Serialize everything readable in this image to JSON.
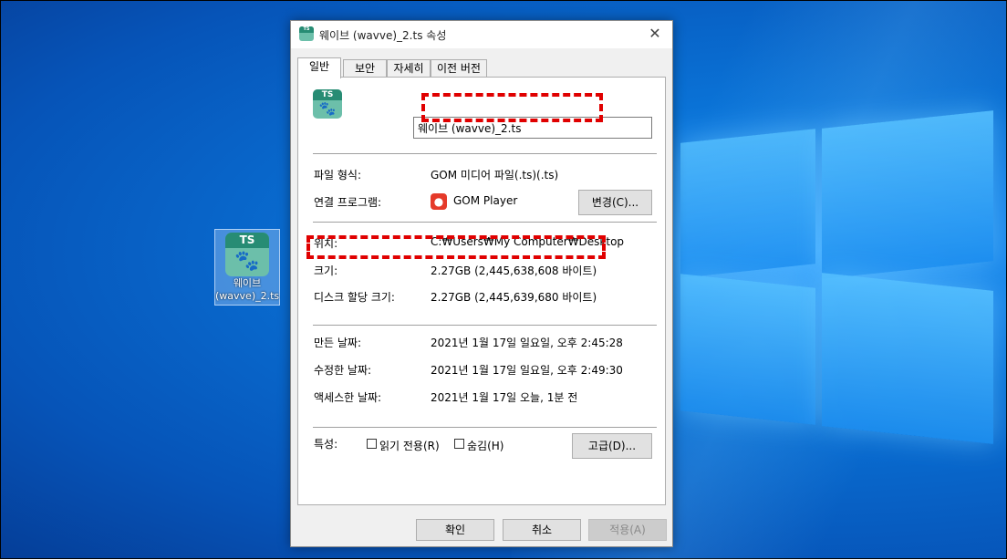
{
  "desktop_icon": {
    "badge": "TS",
    "label": "웨이브 (wavve)_2.ts"
  },
  "dialog": {
    "title": "웨이브 (wavve)_2.ts 속성",
    "close": "✕",
    "tabs": [
      "일반",
      "보안",
      "자세히",
      "이전 버전"
    ],
    "file_badge": "TS",
    "file_name": "웨이브 (wavve)_2.ts",
    "rows": {
      "file_type_label": "파일 형식:",
      "file_type_value": "GOM 미디어 파일(.ts)(.ts)",
      "opens_with_label": "연결 프로그램:",
      "opens_with_value": "GOM Player",
      "change_button": "변경(C)...",
      "location_label": "위치:",
      "location_value": "C:₩Users₩My Computer₩Desktop",
      "size_label": "크기:",
      "size_value": "2.27GB (2,445,638,608 바이트)",
      "disk_size_label": "디스크 할당 크기:",
      "disk_size_value": "2.27GB (2,445,639,680 바이트)",
      "created_label": "만든 날짜:",
      "created_value": "2021년 1월 17일 일요일, 오후 2:45:28",
      "modified_label": "수정한 날짜:",
      "modified_value": "2021년 1월 17일 일요일, 오후 2:49:30",
      "accessed_label": "액세스한 날짜:",
      "accessed_value": "2021년 1월 17일 오늘, 1분 전",
      "attributes_label": "특성:",
      "readonly_label": "읽기 전용(R)",
      "hidden_label": "숨김(H)",
      "advanced_button": "고급(D)..."
    },
    "footer": {
      "ok": "확인",
      "cancel": "취소",
      "apply": "적용(A)"
    }
  },
  "colors": {
    "highlight": "#e00000",
    "desktop": "#0a72d6",
    "ts_icon": "#278c74"
  }
}
